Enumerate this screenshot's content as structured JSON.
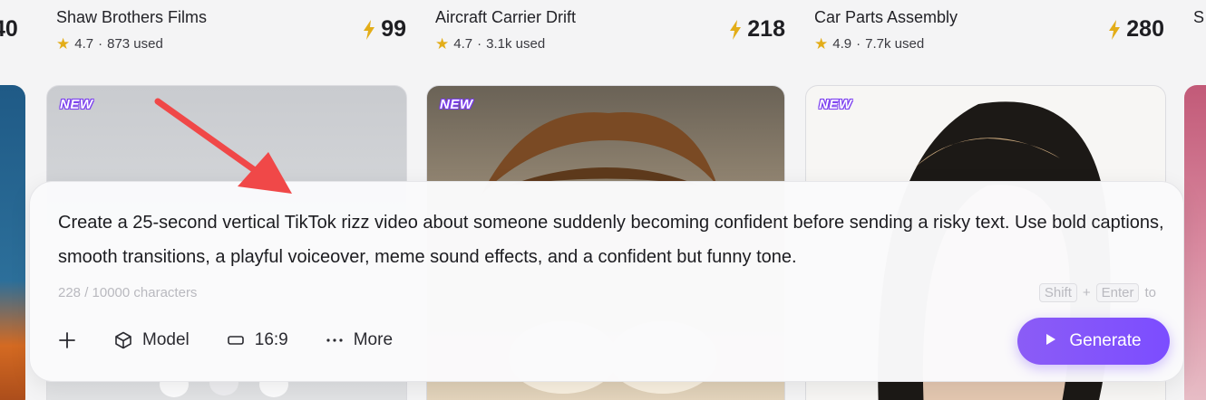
{
  "templates": [
    {
      "cost_partial": "40"
    },
    {
      "title": "Shaw Brothers Films",
      "rating": "4.7",
      "used": "873 used",
      "cost": "99",
      "badge": "NEW"
    },
    {
      "title": "Aircraft Carrier Drift",
      "rating": "4.7",
      "used": "3.1k used",
      "cost": "218",
      "badge": "NEW"
    },
    {
      "title": "Car Parts Assembly",
      "rating": "4.9",
      "used": "7.7k used",
      "cost": "280",
      "badge": "NEW"
    },
    {
      "title_partial": "S"
    }
  ],
  "meta_separator": "·",
  "prompt": {
    "text": "Create a 25-second vertical TikTok rizz video about someone suddenly becoming confident before sending a risky text. Use bold captions, smooth transitions, a playful voiceover, meme sound effects, and a confident but funny tone.",
    "char_count": "228 / 10000 characters",
    "shortcut": {
      "key1": "Shift",
      "plus": "+",
      "key2": "Enter",
      "suffix": "to"
    },
    "toolbar": {
      "add_icon": "plus-icon",
      "model_label": "Model",
      "ratio_label": "16:9",
      "more_label": "More"
    },
    "generate_label": "Generate"
  },
  "colors": {
    "accent": "#7c4dff",
    "star": "#e3ad18",
    "annotation_arrow": "#f04848"
  }
}
